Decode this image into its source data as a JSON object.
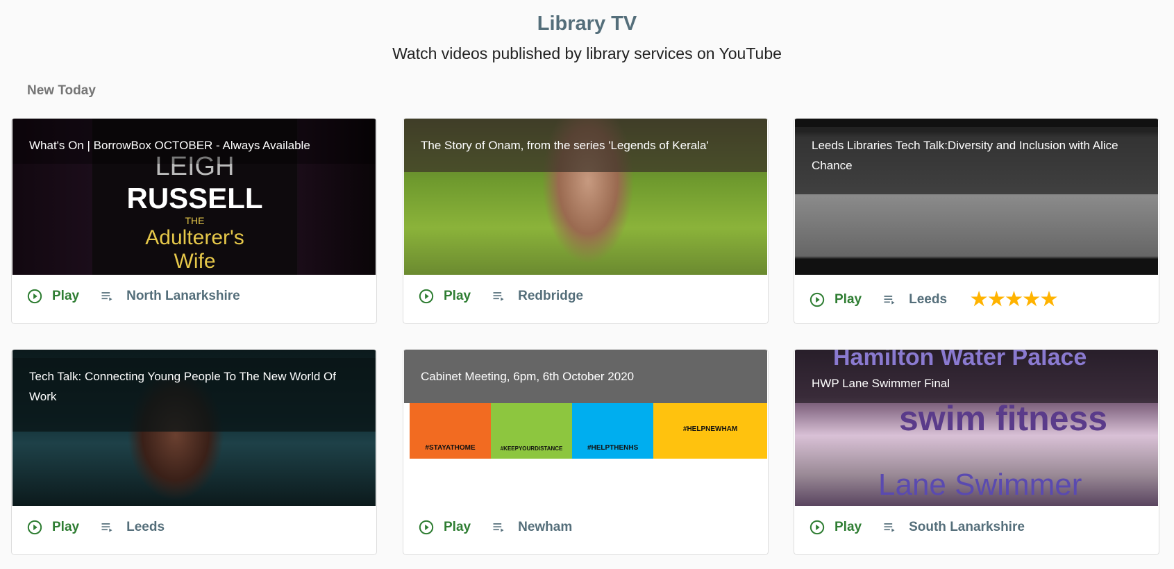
{
  "header": {
    "title": "Library TV",
    "subtitle": "Watch videos published by library services on YouTube"
  },
  "section": "New Today",
  "play_label": "Play",
  "colors": {
    "accent": "#2e7d32",
    "library": "#546e7a",
    "star": "#ffb300"
  },
  "videos": [
    {
      "title": "What's On | BorrowBox OCTOBER - Always Available",
      "library": "North Lanarkshire",
      "thumb_text": [
        "LEIGH",
        "RUSSELL",
        "THE",
        "Adulterer's",
        "Wife"
      ]
    },
    {
      "title": "The Story of Onam, from the series 'Legends of Kerala'",
      "library": "Redbridge"
    },
    {
      "title": "Leeds Libraries Tech Talk:Diversity and Inclusion with Alice Chance",
      "library": "Leeds",
      "rating": "★★★★★"
    },
    {
      "title": "Tech Talk: Connecting Young People To The New World Of Work",
      "library": "Leeds"
    },
    {
      "title": "Cabinet Meeting, 6pm, 6th October 2020",
      "library": "Newham",
      "thumb_text": [
        "#STAYATHOME",
        "#KEEPYOURDISTANCE",
        "#HELPTHENHS",
        "#HELPNEWHAM"
      ]
    },
    {
      "title": "HWP Lane Swimmer Final",
      "library": "South Lanarkshire",
      "thumb_text": [
        "Hamilton Water Palace",
        "swim fitness",
        "Lane Swimmer"
      ]
    }
  ]
}
